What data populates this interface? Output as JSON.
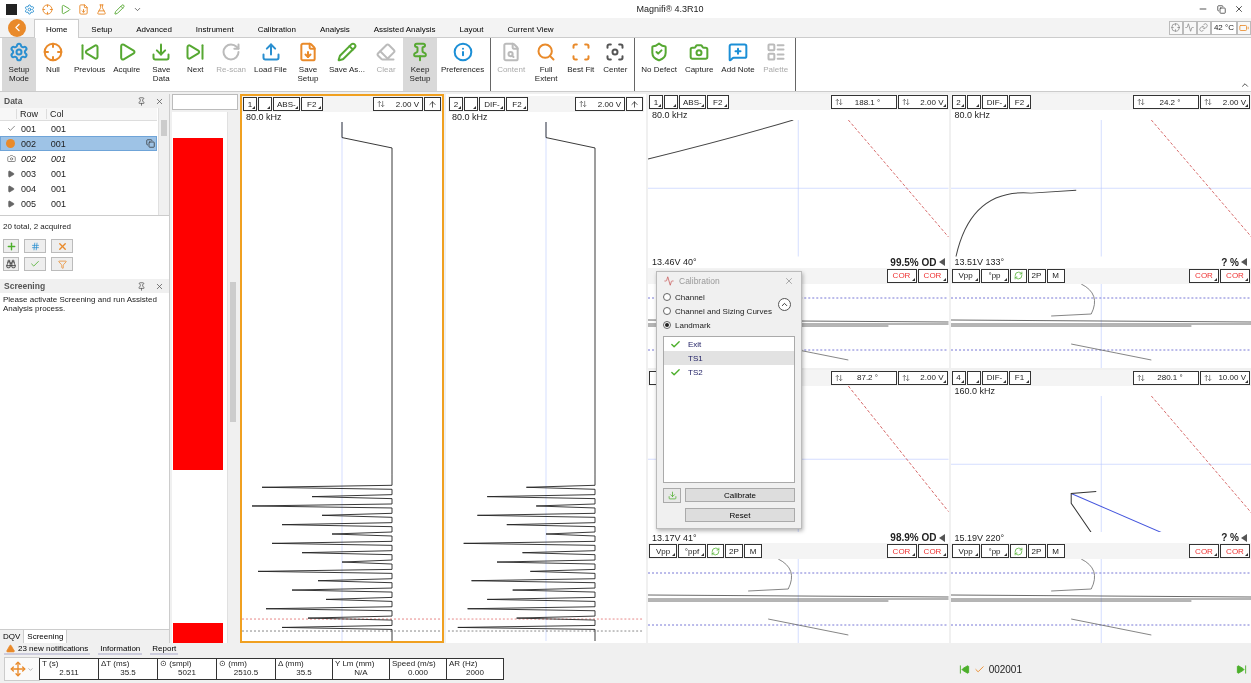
{
  "window": {
    "title": "Magnifi® 4.3R10"
  },
  "ribbon_tabs": [
    {
      "label": "Home",
      "selected": true
    },
    {
      "label": "Setup",
      "selected": false
    },
    {
      "label": "Advanced",
      "selected": false
    },
    {
      "label": "Instrument",
      "selected": false
    },
    {
      "label": "Calibration",
      "selected": false
    },
    {
      "label": "Analysis",
      "selected": false
    },
    {
      "label": "Assisted Analysis",
      "selected": false
    },
    {
      "label": "Layout",
      "selected": false
    },
    {
      "label": "Current View",
      "selected": false
    }
  ],
  "temperature": "42 °C",
  "ribbon_groups": [
    [
      {
        "label": "Setup\nMode",
        "disabled": false,
        "pressed": true
      },
      {
        "label": "Null",
        "disabled": false,
        "pressed": false
      },
      {
        "label": "Previous",
        "disabled": false,
        "pressed": false
      },
      {
        "label": "Acquire",
        "disabled": false,
        "pressed": false
      },
      {
        "label": "Save\nData",
        "disabled": false,
        "pressed": false
      },
      {
        "label": "Next",
        "disabled": false,
        "pressed": false
      },
      {
        "label": "Re-scan",
        "disabled": true,
        "pressed": false
      },
      {
        "label": "Load File",
        "disabled": false,
        "pressed": false
      },
      {
        "label": "Save\nSetup",
        "disabled": false,
        "pressed": false
      },
      {
        "label": "Save As...",
        "disabled": false,
        "pressed": false
      },
      {
        "label": "Clear",
        "disabled": true,
        "pressed": false
      },
      {
        "label": "Keep\nSetup",
        "disabled": false,
        "pressed": true
      },
      {
        "label": "Preferences",
        "disabled": false,
        "pressed": false
      }
    ],
    [
      {
        "label": "Content",
        "disabled": true,
        "pressed": false
      },
      {
        "label": "Full\nExtent",
        "disabled": false,
        "pressed": false
      },
      {
        "label": "Best Fit",
        "disabled": false,
        "pressed": false
      },
      {
        "label": "Center",
        "disabled": false,
        "pressed": false
      }
    ],
    [
      {
        "label": "No Defect",
        "disabled": false,
        "pressed": false
      },
      {
        "label": "Capture",
        "disabled": false,
        "pressed": false
      },
      {
        "label": "Add Note",
        "disabled": false,
        "pressed": false
      },
      {
        "label": "Palette",
        "disabled": true,
        "pressed": false
      }
    ]
  ],
  "data_panel": {
    "title": "Data",
    "columns": [
      "Row",
      "Col"
    ],
    "rows": [
      {
        "kind": "acquired",
        "row": "001",
        "col": "001",
        "selected": false
      },
      {
        "kind": "current",
        "row": "002",
        "col": "001",
        "selected": true
      },
      {
        "kind": "capture",
        "row": "002",
        "col": "001",
        "selected": false
      },
      {
        "kind": "pending",
        "row": "003",
        "col": "001",
        "selected": false
      },
      {
        "kind": "pending",
        "row": "004",
        "col": "001",
        "selected": false
      },
      {
        "kind": "pending",
        "row": "005",
        "col": "001",
        "selected": false
      }
    ],
    "summary": "20 total, 2 acquired"
  },
  "screening_panel": {
    "title": "Screening",
    "message": "Please activate Screening and run Assisted Analysis process."
  },
  "panel_tabs": [
    {
      "label": "DQV",
      "selected": false
    },
    {
      "label": "Screening",
      "selected": true
    }
  ],
  "strips": [
    {
      "channel": "1",
      "mode": "ABS-",
      "code": "F2",
      "scale": "2.00 V",
      "frequency": "80.0 kHz",
      "selected": true
    },
    {
      "channel": "2",
      "mode": "DIF-",
      "code": "F2",
      "scale": "2.00 V",
      "frequency": "80.0 kHz",
      "selected": false
    }
  ],
  "lissajous": [
    {
      "channel": "1",
      "mode": "ABS-",
      "code": "F2",
      "rotation": "188.1 °",
      "scale": "2.00 V",
      "frequency": "80.0 kHz",
      "reading": "13.46V 40°",
      "result": "99.5% OD",
      "controls": [
        "COR",
        "COR"
      ]
    },
    {
      "channel": "2",
      "mode": "DIF-",
      "code": "F2",
      "rotation": "24.2 °",
      "scale": "2.00 V",
      "frequency": "80.0 kHz",
      "reading": "13.51V 133°",
      "result": "? %",
      "units": [
        "Vpp",
        "°pp"
      ],
      "modes": [
        "2P",
        "M"
      ],
      "controls": [
        "COR",
        "COR"
      ]
    },
    {
      "rotation": "87.2 °",
      "scale": "2.00 V",
      "reading": "13.17V 41°",
      "result": "98.9% OD",
      "units": [
        "Vpp",
        "°ppf"
      ],
      "modes": [
        "2P",
        "M"
      ],
      "controls": [
        "COR",
        "COR"
      ]
    },
    {
      "channel": "4",
      "mode": "DIF-",
      "code": "F1",
      "rotation": "280.1 °",
      "scale": "10.00 V",
      "frequency": "160.0 kHz",
      "reading": "15.19V 220°",
      "result": "? %",
      "units": [
        "Vpp",
        "°pp"
      ],
      "modes": [
        "2P",
        "M"
      ],
      "controls": [
        "COR",
        "COR"
      ]
    }
  ],
  "calibration_dialog": {
    "title": "Calibration",
    "options": [
      {
        "label": "Channel",
        "selected": false
      },
      {
        "label": "Channel and Sizing Curves",
        "selected": false
      },
      {
        "label": "Landmark",
        "selected": true
      }
    ],
    "landmarks": [
      {
        "label": "Exit",
        "checked": true,
        "selected": false
      },
      {
        "label": "TS1",
        "checked": false,
        "selected": true
      },
      {
        "label": "TS2",
        "checked": true,
        "selected": false
      }
    ],
    "buttons": [
      "Calibrate",
      "Reset"
    ]
  },
  "notifications": [
    {
      "label": "23 new notifications",
      "kind": "warning"
    },
    {
      "label": "Information",
      "kind": "plain"
    },
    {
      "label": "Report",
      "kind": "plain"
    }
  ],
  "measurements": [
    {
      "label": "T (s)",
      "value": "2.511"
    },
    {
      "label": "ΔT (ms)",
      "value": "35.5"
    },
    {
      "label": "⊙ (smpl)",
      "value": "5021"
    },
    {
      "label": "⊙ (mm)",
      "value": "2510.5"
    },
    {
      "label": "Δ (mm)",
      "value": "35.5"
    },
    {
      "label": "Y Lm (mm)",
      "value": "N/A"
    },
    {
      "label": "Speed (m/s)",
      "value": "0.000"
    },
    {
      "label": "AR (Hz)",
      "value": "2000"
    }
  ],
  "record": "002001"
}
